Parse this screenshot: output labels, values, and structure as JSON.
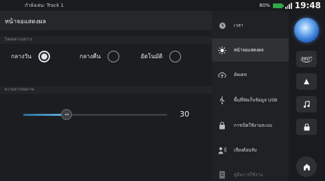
{
  "status_bar": {
    "now_playing": "กำลังเล่น: Track 1",
    "battery_percent": "80%",
    "time": "19:48"
  },
  "display_settings": {
    "title": "หน้าจอแสดงผล",
    "mode_section_label": "โหมดความสว่าง",
    "mode_options": [
      {
        "label": "กลางวัน",
        "selected": true
      },
      {
        "label": "กลางคืน",
        "selected": false
      },
      {
        "label": "อัตโนมัติ",
        "selected": false
      }
    ],
    "brightness_section_label": "ความสว่างจอภาพ",
    "brightness_value": 30,
    "brightness_max": 100
  },
  "menu": {
    "items": [
      {
        "label": "เวลา",
        "icon": "clock-icon",
        "active": false
      },
      {
        "label": "หน้าจอแสดงผล",
        "icon": "brightness-icon",
        "active": true
      },
      {
        "label": "อัพเดท",
        "icon": "cloud-update-icon",
        "active": false
      },
      {
        "label": "พื้นที่จัดเก็บข้อมูล USB",
        "icon": "usb-icon",
        "active": false
      },
      {
        "label": "การเปิดใช้งานระบบ",
        "icon": "lock-icon",
        "active": false
      },
      {
        "label": "เสียงต้อนรับ",
        "icon": "person-voice-icon",
        "active": false
      },
      {
        "label": "คู่มือการใช้งาน",
        "icon": "manual-icon",
        "active": false
      }
    ]
  },
  "dock": {
    "view_360_label": "360°",
    "buttons": [
      "logo-icon",
      "view-360-icon",
      "navigation-arrow-icon",
      "music-note-icon",
      "lock-icon",
      "home-icon"
    ]
  },
  "colors": {
    "accent": "#4aa3e0",
    "selected_radio": "#dfe3e8",
    "active_menu_bg": "#2f3134"
  }
}
